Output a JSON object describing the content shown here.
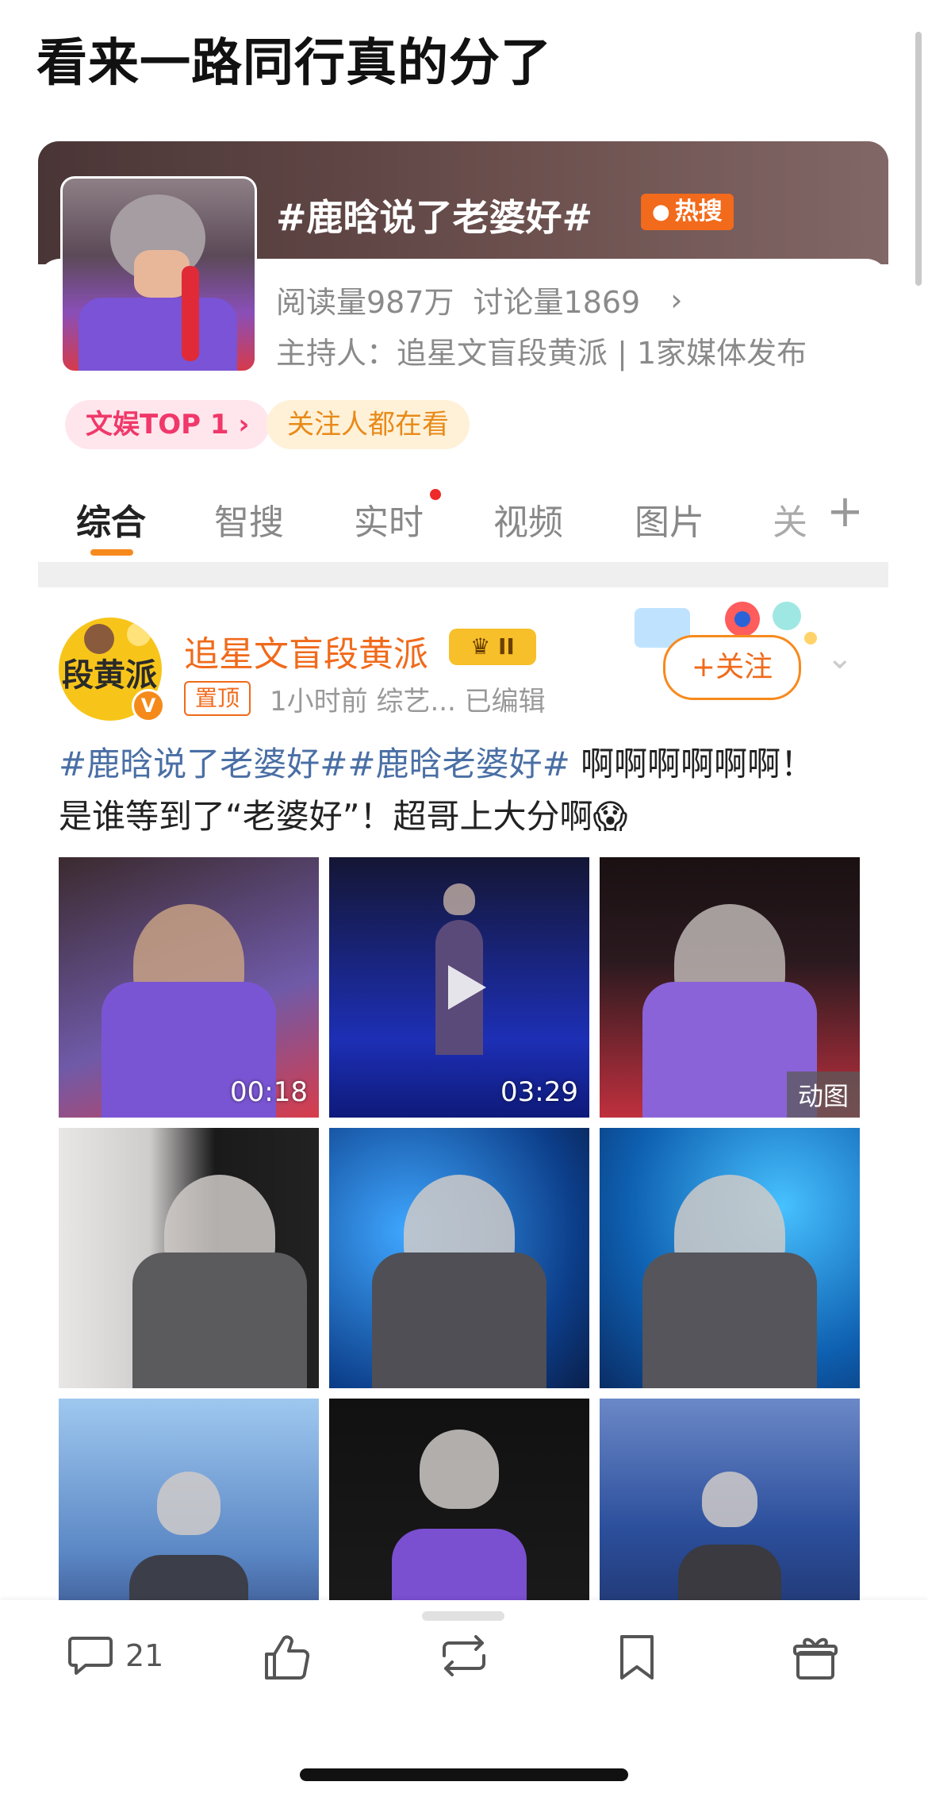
{
  "headline": "看来一路同行真的分了",
  "topic": {
    "title": "#鹿晗说了老婆好#",
    "hot_badge": "热搜",
    "reads": "阅读量987万",
    "discussions": "讨论量1869",
    "arrow": "›",
    "host": "主持人：追星文盲段黄派 | 1家媒体发布",
    "pill_rank": "文娱TOP 1 ›",
    "pill_follow": "关注人都在看"
  },
  "tabs": [
    {
      "label": "综合",
      "active": true
    },
    {
      "label": "智搜"
    },
    {
      "label": "实时",
      "dot": true
    },
    {
      "label": "视频"
    },
    {
      "label": "图片"
    },
    {
      "label": "关"
    }
  ],
  "tabs_more": "+",
  "post": {
    "avatar_text": "段黄派",
    "verified": "V",
    "author": "追星文盲段黄派",
    "level": "II",
    "pinned": "置顶",
    "meta": "1小时前   综艺...   已编辑",
    "follow": "+关注",
    "tag1": "#鹿晗说了老婆好#",
    "tag2": "#鹿晗老婆好#",
    "text1": " 啊啊啊啊啊啊！",
    "text2": "是谁等到了“老婆好”！超哥上大分啊😱",
    "media": [
      {
        "label": "00:18",
        "kind": "video"
      },
      {
        "label": "03:29",
        "kind": "video"
      },
      {
        "label": "动图",
        "kind": "gif"
      },
      {
        "label": "",
        "kind": "image"
      },
      {
        "label": "",
        "kind": "image"
      },
      {
        "label": "",
        "kind": "image"
      },
      {
        "label": "",
        "kind": "image"
      },
      {
        "label": "",
        "kind": "image"
      },
      {
        "label": "",
        "kind": "image"
      }
    ]
  },
  "actions": {
    "comment_count": "21"
  },
  "colors": {
    "accent": "#f78a1d",
    "author": "#f06a1b",
    "hashtag": "#4a6fa5",
    "hot": "#f26a1b"
  }
}
